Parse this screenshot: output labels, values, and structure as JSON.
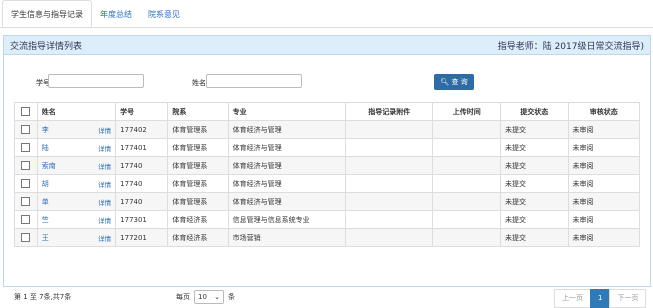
{
  "tabs": [
    "学生信息与指导记录",
    "年度总结",
    "院系意见"
  ],
  "panel": {
    "title": "交流指导详情列表",
    "right": "指导老师：陆 2017级日常交流指导)"
  },
  "search": {
    "label_id": "学号",
    "label_name": "姓名",
    "button": "查 询"
  },
  "table": {
    "headers": [
      "姓名",
      "学号",
      "院系",
      "专业",
      "指导记录附件",
      "上传时间",
      "提交状态",
      "审核状态"
    ],
    "detail_label": "详情",
    "rows": [
      {
        "name": "李",
        "id": "177402",
        "dept": "体育管理系",
        "major": "体育经济与管理",
        "status": "未提交",
        "review": "未审阅"
      },
      {
        "name": "陆",
        "id": "177401",
        "dept": "体育管理系",
        "major": "体育经济与管理",
        "status": "未提交",
        "review": "未审阅"
      },
      {
        "name": "索南",
        "id": "17740",
        "dept": "体育管理系",
        "major": "体育经济与管理",
        "status": "未提交",
        "review": "未审阅"
      },
      {
        "name": "胡",
        "id": "17740",
        "dept": "体育管理系",
        "major": "体育经济与管理",
        "status": "未提交",
        "review": "未审阅"
      },
      {
        "name": "单",
        "id": "17740",
        "dept": "体育管理系",
        "major": "体育经济与管理",
        "status": "未提交",
        "review": "未审阅"
      },
      {
        "name": "竺",
        "id": "177301",
        "dept": "体育经济系",
        "major": "信息管理与信息系统专业",
        "status": "未提交",
        "review": "未审阅"
      },
      {
        "name": "王",
        "id": "177201",
        "dept": "体育经济系",
        "major": "市场营销",
        "status": "未提交",
        "review": "未审阅"
      }
    ]
  },
  "footer": {
    "summary": "第 1 至 7条,共7条",
    "perpage_label": "每页",
    "perpage_value": "10",
    "perpage_unit": "条"
  },
  "pager": {
    "prev": "上一页",
    "current": "1",
    "next": "下一页"
  }
}
